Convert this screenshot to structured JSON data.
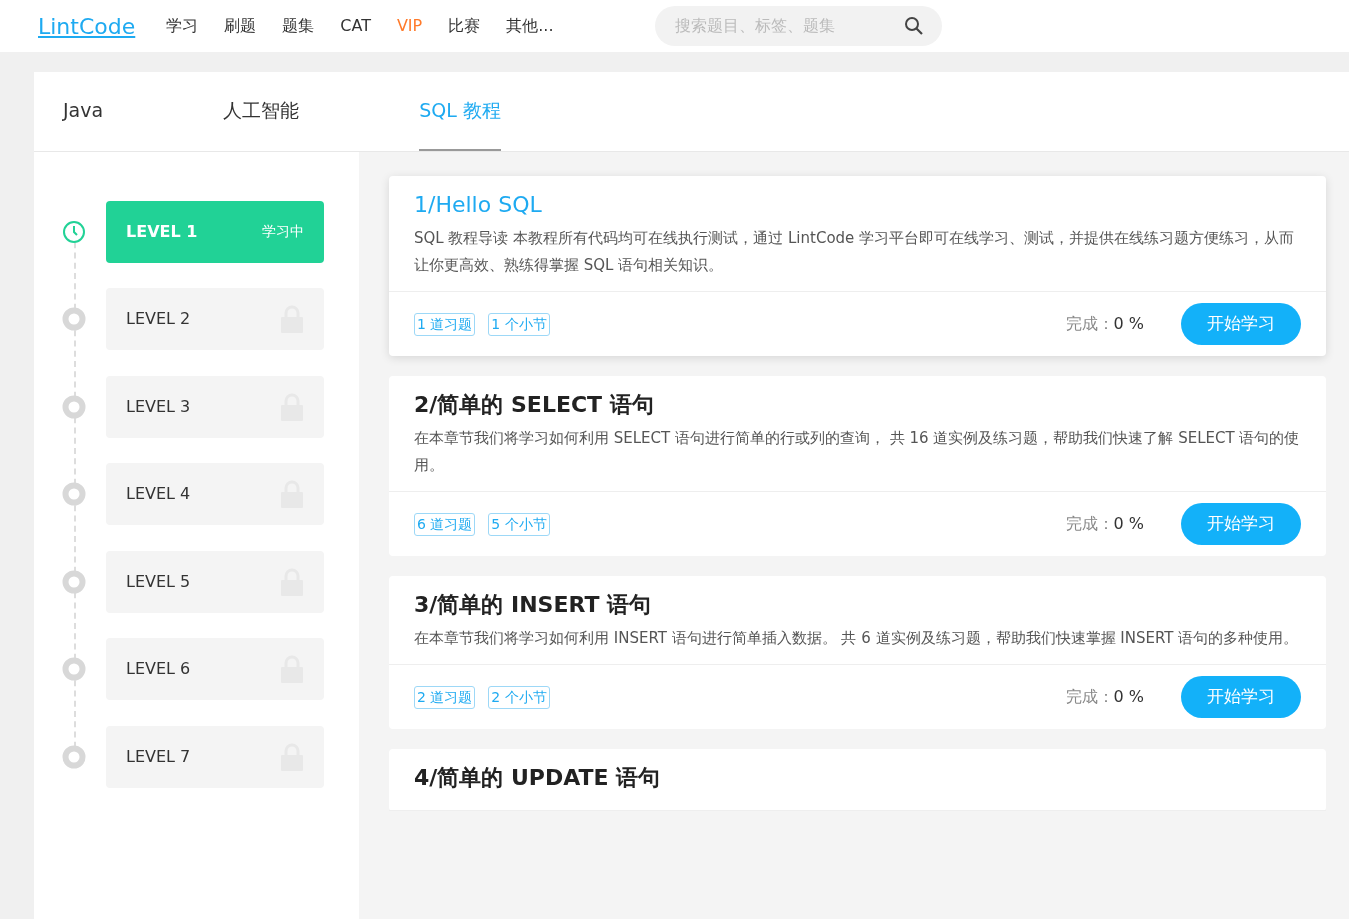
{
  "navbar": {
    "logo": "LintCode",
    "links": [
      {
        "label": "学习",
        "highlight": false
      },
      {
        "label": "刷题",
        "highlight": false
      },
      {
        "label": "题集",
        "highlight": false
      },
      {
        "label": "CAT",
        "highlight": false
      },
      {
        "label": "VIP",
        "highlight": true
      },
      {
        "label": "比赛",
        "highlight": false
      },
      {
        "label": "其他..."
      }
    ],
    "search": {
      "placeholder": "搜索题目、标签、题集"
    }
  },
  "tabs": [
    {
      "label": "Java",
      "selected": false
    },
    {
      "label": "人工智能",
      "selected": false
    },
    {
      "label": "SQL 教程",
      "selected": true
    }
  ],
  "levels": [
    {
      "label": "LEVEL 1",
      "locked": false,
      "badge": "学习中"
    },
    {
      "label": "LEVEL 2",
      "locked": true
    },
    {
      "label": "LEVEL 3",
      "locked": true
    },
    {
      "label": "LEVEL 4",
      "locked": true
    },
    {
      "label": "LEVEL 5",
      "locked": true
    },
    {
      "label": "LEVEL 6",
      "locked": true
    },
    {
      "label": "LEVEL 7",
      "locked": true
    }
  ],
  "chapters": [
    {
      "title": "1/Hello SQL",
      "selected": true,
      "description": "SQL 教程导读 本教程所有代码均可在线执行测试，通过 LintCode 学习平台即可在线学习、测试，并提供在线练习题方便练习，从而让你更高效、熟练得掌握 SQL 语句相关知识。",
      "tags": [
        "1 道习题",
        "1 个小节"
      ],
      "progress_label": "完成：",
      "progress": "0 %",
      "button": "开始学习"
    },
    {
      "title": "2/简单的 SELECT 语句",
      "selected": false,
      "description": "在本章节我们将学习如何利用 SELECT 语句进行简单的行或列的查询， 共 16 道实例及练习题，帮助我们快速了解 SELECT 语句的使用。",
      "tags": [
        "6 道习题",
        "5 个小节"
      ],
      "progress_label": "完成：",
      "progress": "0 %",
      "button": "开始学习"
    },
    {
      "title": "3/简单的 INSERT 语句",
      "selected": false,
      "description": "在本章节我们将学习如何利用 INSERT 语句进行简单插入数据。 共 6 道实例及练习题，帮助我们快速掌握 INSERT 语句的多种使用。",
      "tags": [
        "2 道习题",
        "2 个小节"
      ],
      "progress_label": "完成：",
      "progress": "0 %",
      "button": "开始学习"
    },
    {
      "title": "4/简单的 UPDATE 语句",
      "selected": false
    }
  ]
}
